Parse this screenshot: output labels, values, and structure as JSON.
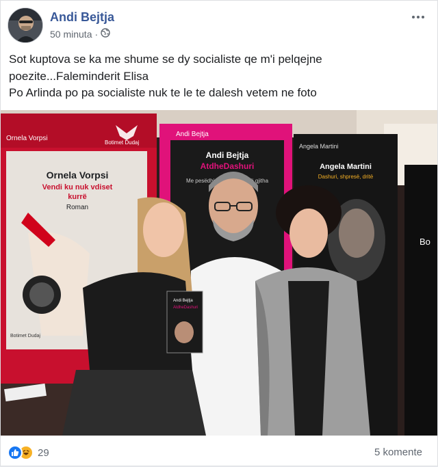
{
  "post": {
    "author": "Andi Bejtja",
    "time": "50 minuta",
    "separator": "·",
    "privacy_icon": "globe-icon",
    "menu_icon": "more-dots-icon",
    "text_lines": [
      "Sot kuptova se ka me shume se dy socialiste qe m'i pelqejne",
      "poezite...Faleminderit Elisa",
      "Po Arlinda po pa socialiste nuk te le te dalesh vetem ne foto"
    ]
  },
  "photo": {
    "poster_left": {
      "author": "Ornela Vorpsi",
      "title_line1": "Vendi ku nuk vdiset",
      "title_line2": "kurrë",
      "genre": "Roman",
      "publisher": "Botimet Dudaj",
      "top_author": "Ornela Vorpsi",
      "top_publisher": "Botimet Dudaj"
    },
    "poster_center": {
      "top_author": "Andi Bejtja",
      "author": "Andi Bejtja",
      "title": "AtdheDashuri",
      "subtitle": "Me pesëdhjetë dashuri ... të gjitha"
    },
    "poster_right": {
      "top_author": "Angela Martini",
      "author": "Angela Martini",
      "title": "Dashuri, shpresë, dritë"
    },
    "poster_far_right": {
      "text": "Bo"
    },
    "held_book": {
      "author": "Andi Bejtja",
      "title": "AtdheDashuri"
    }
  },
  "footer": {
    "reaction_icons": [
      "like-icon",
      "haha-icon"
    ],
    "reaction_count": "29",
    "comments": "5 komente"
  },
  "colors": {
    "link_blue": "#385898",
    "like_blue": "#1877f2",
    "haha_yellow": "#f7b125",
    "poster_red": "#c8102e",
    "poster_pink": "#e0127a"
  }
}
